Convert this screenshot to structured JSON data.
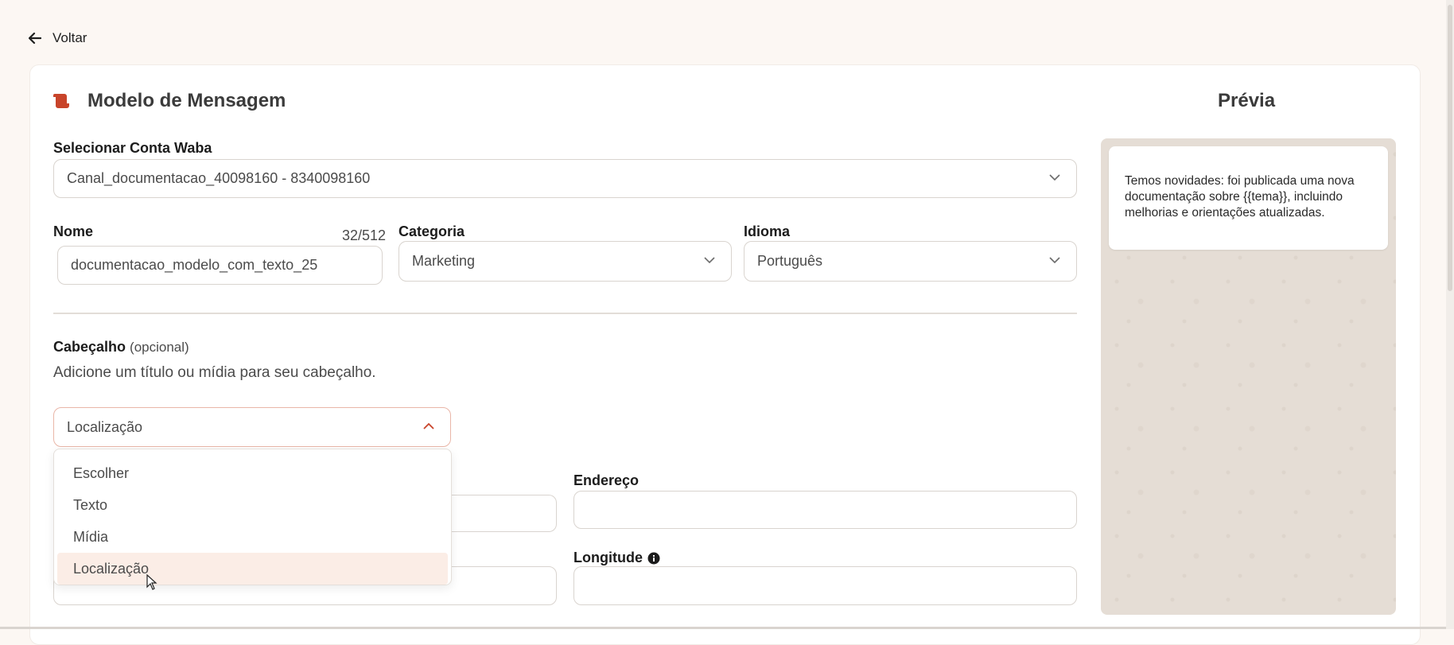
{
  "nav": {
    "back_label": "Voltar"
  },
  "form": {
    "title": "Modelo de Mensagem",
    "waba": {
      "label": "Selecionar Conta Waba",
      "value": "Canal_documentacao_40098160 - 8340098160"
    },
    "nome": {
      "label": "Nome",
      "counter": "32/512",
      "value": "documentacao_modelo_com_texto_25"
    },
    "categoria": {
      "label": "Categoria",
      "value": "Marketing"
    },
    "idioma": {
      "label": "Idioma",
      "value": "Português"
    },
    "cabecalho": {
      "label": "Cabeçalho",
      "optional": "(opcional)",
      "description": "Adicione um título ou mídia para seu cabeçalho.",
      "selected": "Localização",
      "options": [
        "Escolher",
        "Texto",
        "Mídia",
        "Localização"
      ]
    },
    "endereco": {
      "label": "Endereço",
      "value": ""
    },
    "longitude": {
      "label": "Longitude",
      "value": ""
    }
  },
  "preview": {
    "title": "Prévia",
    "message": "Temos novidades: foi publicada uma nova documentação sobre {{tema}}, incluindo melhorias e orientações atualizadas."
  },
  "colors": {
    "accent": "#c8442a",
    "selected_bg": "#fbede6",
    "page_bg": "#fcf7f3"
  }
}
